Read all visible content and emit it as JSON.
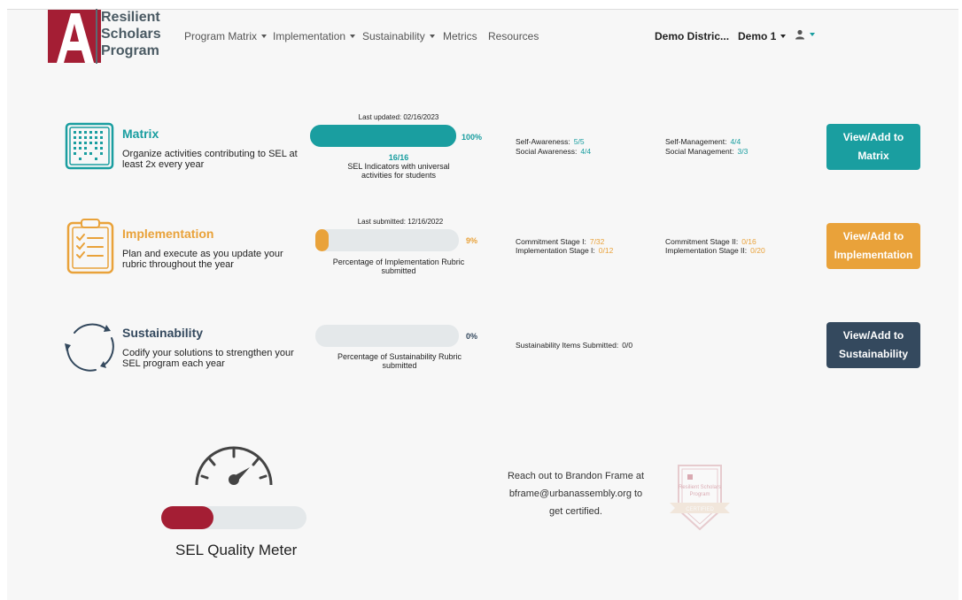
{
  "header": {
    "logo": {
      "letter": "A",
      "line1": "Resilient",
      "line2": "Scholars",
      "line3": "Program"
    },
    "nav": [
      {
        "label": "Program Matrix",
        "dropdown": true
      },
      {
        "label": "Implementation",
        "dropdown": true
      },
      {
        "label": "Sustainability",
        "dropdown": true
      },
      {
        "label": "Metrics",
        "dropdown": false
      },
      {
        "label": "Resources",
        "dropdown": false
      }
    ],
    "district": "Demo Distric...",
    "school": "Demo 1",
    "user_icon": "user-icon"
  },
  "colors": {
    "teal": "#1a9ea0",
    "orange": "#e9a23a",
    "navy": "#34495e",
    "red": "#a41e34",
    "track": "#e4e8ea"
  },
  "rows": {
    "matrix": {
      "title": "Matrix",
      "desc": "Organize activities contributing to SEL at least 2x every year",
      "updated": "Last updated: 02/16/2023",
      "percent": "100%",
      "progress": 1.0,
      "count": "16/16",
      "caption": "SEL Indicators with universal activities for students",
      "stats_left": [
        {
          "label": "Self-Awareness:",
          "value": "5/5"
        },
        {
          "label": "Social Awareness:",
          "value": "4/4"
        }
      ],
      "stats_right": [
        {
          "label": "Self-Management:",
          "value": "4/4"
        },
        {
          "label": "Social Management:",
          "value": "3/3"
        }
      ],
      "button": [
        "View/Add to",
        "Matrix"
      ]
    },
    "implementation": {
      "title": "Implementation",
      "desc": "Plan and execute as you update your rubric throughout the year",
      "updated": "Last submitted: 12/16/2022",
      "percent": "9%",
      "progress": 0.09,
      "caption": "Percentage of Implementation Rubric submitted",
      "stats_left": [
        {
          "label": "Commitment Stage I:",
          "value": "7/32"
        },
        {
          "label": "Implementation Stage I:",
          "value": "0/12"
        }
      ],
      "stats_right": [
        {
          "label": "Commitment Stage II:",
          "value": "0/16"
        },
        {
          "label": "Implementation Stage II:",
          "value": "0/20"
        }
      ],
      "button": [
        "View/Add to",
        "Implementation"
      ]
    },
    "sustainability": {
      "title": "Sustainability",
      "desc": "Codify your solutions to strengthen your SEL program each year",
      "percent": "0%",
      "progress": 0.0,
      "caption": "Percentage of Sustainability Rubric submitted",
      "stat": {
        "label": "Sustainability Items Submitted:",
        "value": "0/0"
      },
      "button": [
        "View/Add to",
        "Sustainability"
      ]
    }
  },
  "meter": {
    "label": "SEL Quality Meter",
    "level": 0.36
  },
  "certify": {
    "message": "Reach out to Brandon Frame at bframe@urbanassembly.org to get certified.",
    "badge_line1": "Resilient Scholars",
    "badge_line2": "Program",
    "badge_ribbon": "CERTIFIED"
  }
}
